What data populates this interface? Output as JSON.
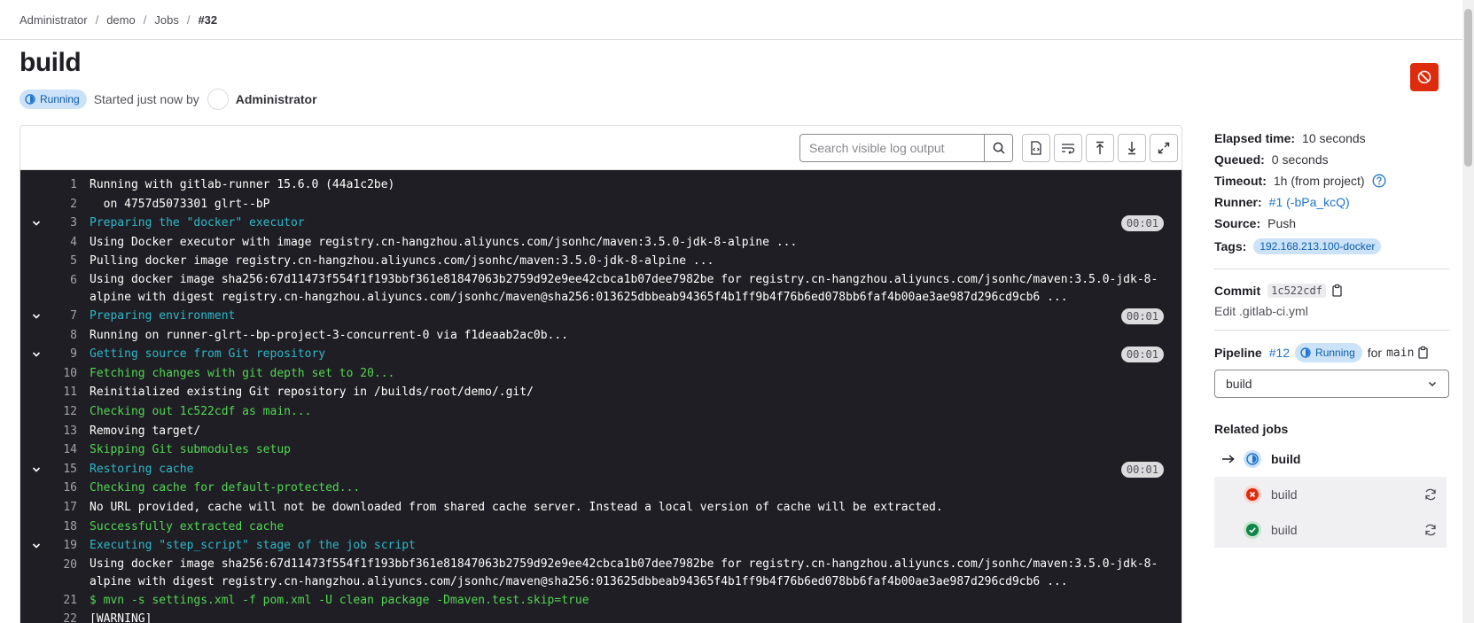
{
  "breadcrumb": [
    "Administrator",
    "demo",
    "Jobs",
    "#32"
  ],
  "title": "build",
  "status": {
    "badge": "Running",
    "started": "Started just now by",
    "user": "Administrator"
  },
  "toolbar": {
    "search_placeholder": "Search visible log output"
  },
  "log": [
    {
      "n": "1",
      "t": "Running with gitlab-runner 15.6.0 (44a1c2be)",
      "c": "white"
    },
    {
      "n": "2",
      "t": "  on 4757d5073301 glrt--bP",
      "c": "white"
    },
    {
      "n": "3",
      "t": "Preparing the \"docker\" executor",
      "c": "cyan",
      "section": true,
      "dur": "00:01"
    },
    {
      "n": "4",
      "t": "Using Docker executor with image registry.cn-hangzhou.aliyuncs.com/jsonhc/maven:3.5.0-jdk-8-alpine ...",
      "c": "white"
    },
    {
      "n": "5",
      "t": "Pulling docker image registry.cn-hangzhou.aliyuncs.com/jsonhc/maven:3.5.0-jdk-8-alpine ...",
      "c": "white"
    },
    {
      "n": "6",
      "t": "Using docker image sha256:67d11473f554f1f193bbf361e81847063b2759d92e9ee42cbca1b07dee7982be for registry.cn-hangzhou.aliyuncs.com/jsonhc/maven:3.5.0-jdk-8-alpine with digest registry.cn-hangzhou.aliyuncs.com/jsonhc/maven@sha256:013625dbbeab94365f4b1ff9b4f76b6ed078bb6faf4b00ae3ae987d296cd9cb6 ...",
      "c": "white",
      "wrap": true
    },
    {
      "n": "7",
      "t": "Preparing environment",
      "c": "cyan",
      "section": true,
      "dur": "00:01"
    },
    {
      "n": "8",
      "t": "Running on runner-glrt--bp-project-3-concurrent-0 via f1deaab2ac0b...",
      "c": "white"
    },
    {
      "n": "9",
      "t": "Getting source from Git repository",
      "c": "cyan",
      "section": true,
      "dur": "00:01"
    },
    {
      "n": "10",
      "t": "Fetching changes with git depth set to 20...",
      "c": "green"
    },
    {
      "n": "11",
      "t": "Reinitialized existing Git repository in /builds/root/demo/.git/",
      "c": "white"
    },
    {
      "n": "12",
      "t": "Checking out 1c522cdf as main...",
      "c": "green"
    },
    {
      "n": "13",
      "t": "Removing target/",
      "c": "white"
    },
    {
      "n": "14",
      "t": "Skipping Git submodules setup",
      "c": "green"
    },
    {
      "n": "15",
      "t": "Restoring cache",
      "c": "cyan",
      "section": true,
      "dur": "00:01"
    },
    {
      "n": "16",
      "t": "Checking cache for default-protected...",
      "c": "green"
    },
    {
      "n": "17",
      "t": "No URL provided, cache will not be downloaded from shared cache server. Instead a local version of cache will be extracted.",
      "c": "white"
    },
    {
      "n": "18",
      "t": "Successfully extracted cache",
      "c": "green"
    },
    {
      "n": "19",
      "t": "Executing \"step_script\" stage of the job script",
      "c": "cyan",
      "section": true
    },
    {
      "n": "20",
      "t": "Using docker image sha256:67d11473f554f1f193bbf361e81847063b2759d92e9ee42cbca1b07dee7982be for registry.cn-hangzhou.aliyuncs.com/jsonhc/maven:3.5.0-jdk-8-alpine with digest registry.cn-hangzhou.aliyuncs.com/jsonhc/maven@sha256:013625dbbeab94365f4b1ff9b4f76b6ed078bb6faf4b00ae3ae987d296cd9cb6 ...",
      "c": "white",
      "wrap": true
    },
    {
      "n": "21",
      "t": "$ mvn -s settings.xml -f pom.xml -U clean package -Dmaven.test.skip=true",
      "c": "green"
    },
    {
      "n": "22",
      "t": "[WARNING]",
      "c": "white"
    }
  ],
  "sidebar": {
    "elapsed_label": "Elapsed time:",
    "elapsed": "10 seconds",
    "queued_label": "Queued:",
    "queued": "0 seconds",
    "timeout_label": "Timeout:",
    "timeout": "1h (from project)",
    "runner_label": "Runner:",
    "runner": "#1 (-bPa_kcQ)",
    "source_label": "Source:",
    "source": "Push",
    "tags_label": "Tags:",
    "tag": "192.168.213.100-docker",
    "commit_label": "Commit",
    "commit_sha": "1c522cdf",
    "commit_message": "Edit .gitlab-ci.yml",
    "pipeline_label": "Pipeline",
    "pipeline_id": "#12",
    "pipeline_status": "Running",
    "pipeline_for": "for",
    "pipeline_ref": "main",
    "stage_selected": "build",
    "related_title": "Related jobs",
    "related_jobs": [
      {
        "name": "build",
        "status": "running"
      },
      {
        "name": "build",
        "status": "failed"
      },
      {
        "name": "build",
        "status": "success"
      }
    ]
  },
  "colors": {
    "accent": "#1f75cb",
    "danger": "#dd2b0e",
    "success": "#108548",
    "running_bg": "#cbe2f9",
    "log_bg": "#1f1e24"
  }
}
